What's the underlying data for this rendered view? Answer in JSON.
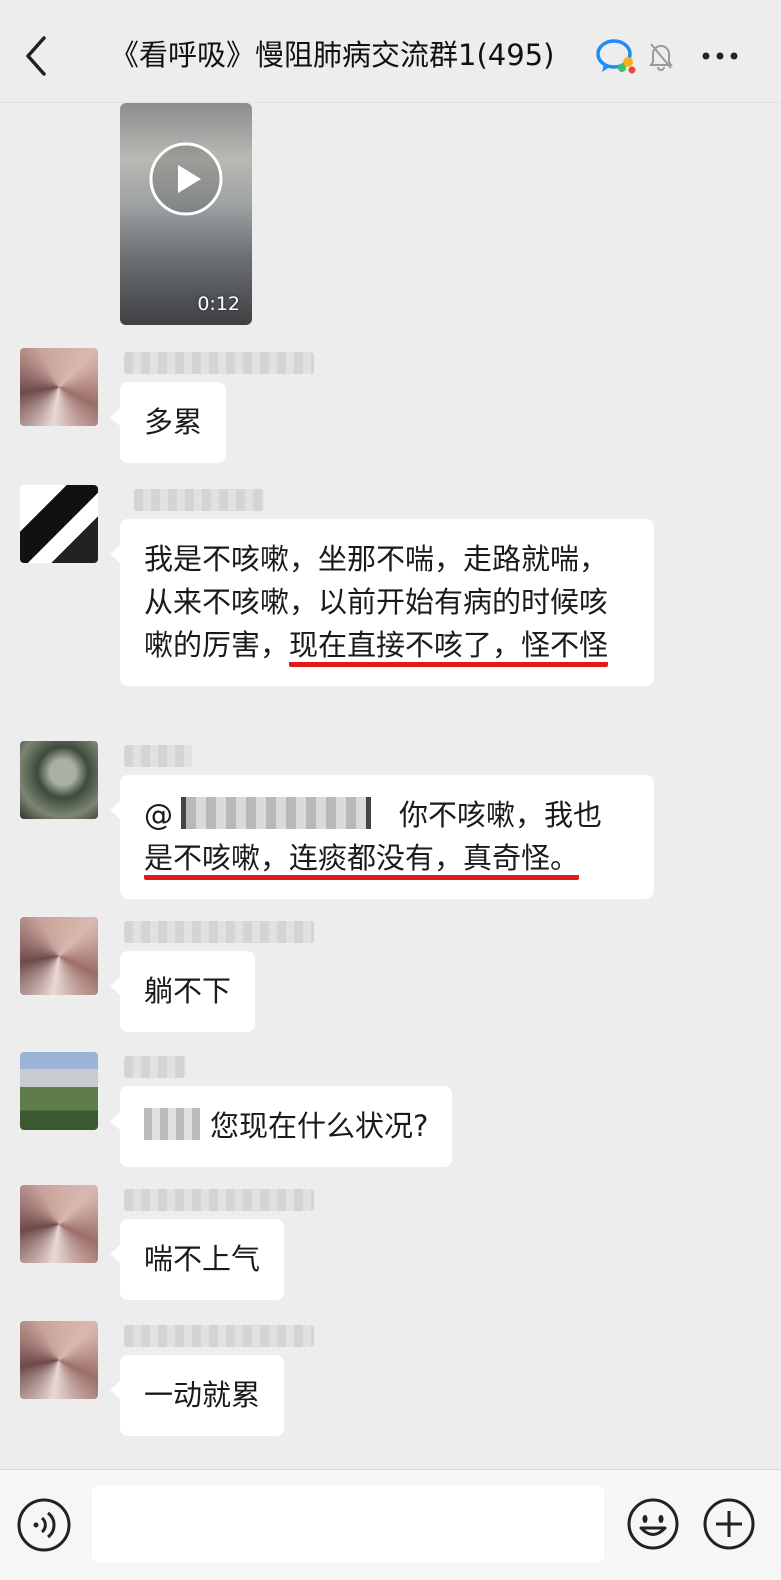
{
  "header": {
    "title": "《看呼吸》慢阻肺病交流群1(495)",
    "back_icon": "chevron-left-icon",
    "robot_icon": "chat-bubble-robot-icon",
    "mute_icon": "bell-off-icon",
    "more_icon": "ellipsis-icon"
  },
  "video": {
    "duration": "0:12",
    "icon": "play-icon"
  },
  "messages": [
    {
      "text": "多累"
    },
    {
      "text_plain": "我是不咳嗽，坐那不喘，走路就喘，从来不咳嗽，以前开始有病的时候咳嗽的厉害，",
      "text_underlined": "现在直接不咳了，怪不怪"
    },
    {
      "mention_prefix": "@",
      "text_rest": "你不咳嗽，我也",
      "text_underlined": "是不咳嗽，连痰都没有，真奇怪。"
    },
    {
      "text": "躺不下"
    },
    {
      "text": "您现在什么状况?"
    },
    {
      "text": "喘不上气"
    },
    {
      "text": "一动就累"
    }
  ],
  "input": {
    "value": "",
    "voice_icon": "voice-icon",
    "emoji_icon": "emoji-icon",
    "plus_icon": "plus-circle-icon"
  },
  "colors": {
    "background": "#ededed",
    "bubble": "#ffffff",
    "underline": "#e01a1a"
  }
}
